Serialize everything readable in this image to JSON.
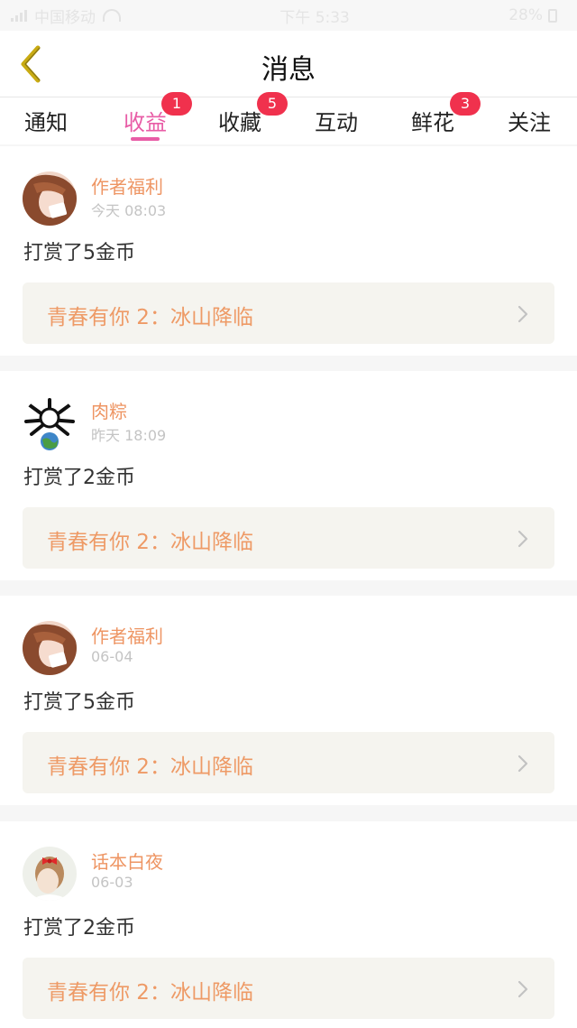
{
  "status_bar": {
    "carrier": "中国移动",
    "time": "下午 5:33",
    "battery": "28%"
  },
  "header": {
    "title": "消息",
    "back_icon": "chevron-left-icon",
    "back_color": "#c9ab12"
  },
  "tabs": [
    {
      "label": "通知",
      "badge": ""
    },
    {
      "label": "收益",
      "badge": "1",
      "active": true
    },
    {
      "label": "收藏",
      "badge": "5"
    },
    {
      "label": "互动",
      "badge": ""
    },
    {
      "label": "鲜花",
      "badge": "3"
    },
    {
      "label": "关注",
      "badge": ""
    }
  ],
  "messages": [
    {
      "sender": "作者福利",
      "time": "今天 08:03",
      "text": "打赏了5金币",
      "book": "青春有你 2：冰山降临"
    },
    {
      "sender": "肉粽",
      "time": "昨天 18:09",
      "text": "打赏了2金币",
      "book": "青春有你 2：冰山降临"
    },
    {
      "sender": "作者福利",
      "time": "06-04",
      "text": "打赏了5金币",
      "book": "青春有你 2：冰山降临"
    },
    {
      "sender": "话本白夜",
      "time": "06-03",
      "text": "打赏了2金币",
      "book": "青春有你 2：冰山降临"
    }
  ],
  "colors": {
    "accent": "#e85ca6",
    "badge": "#f0314d",
    "sender": "#ee9563",
    "book_link": "#ee9a66"
  }
}
